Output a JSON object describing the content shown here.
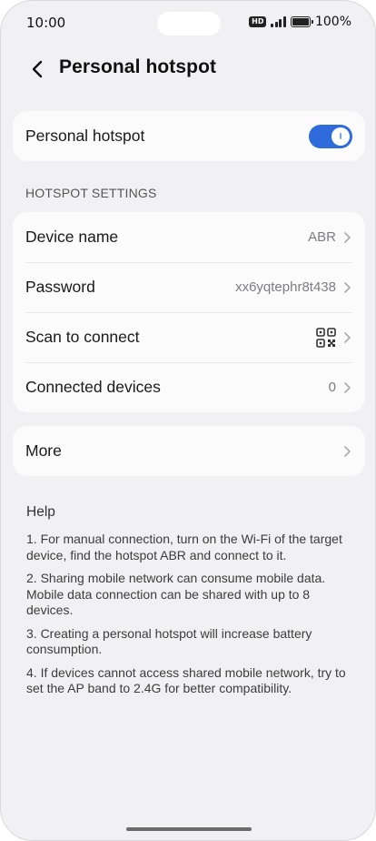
{
  "status": {
    "time": "10:00",
    "hd": "HD",
    "battery": "100%"
  },
  "header": {
    "title": "Personal hotspot"
  },
  "hotspot": {
    "label": "Personal hotspot",
    "enabled": true
  },
  "settings": {
    "section_title": "HOTSPOT SETTINGS",
    "rows": [
      {
        "label": "Device name",
        "value": "ABR"
      },
      {
        "label": "Password",
        "value": "xx6yqtephr8t438"
      },
      {
        "label": "Scan to connect",
        "icon": "qr-code-icon"
      },
      {
        "label": "Connected devices",
        "value": "0"
      }
    ]
  },
  "more": {
    "label": "More"
  },
  "help": {
    "title": "Help",
    "items": [
      "1. For manual connection, turn on the Wi-Fi of the target device, find the hotspot ABR and connect to it.",
      "2. Sharing mobile network can consume mobile data. Mobile data connection can be shared with up to 8 devices.",
      "3. Creating a personal hotspot will increase battery consumption.",
      "4. If devices cannot access shared mobile network, try to set the AP band to 2.4G for better compatibility."
    ]
  },
  "colors": {
    "accent": "#2f6bdb",
    "background": "#f1f1f3",
    "card": "#fbfbfc"
  }
}
